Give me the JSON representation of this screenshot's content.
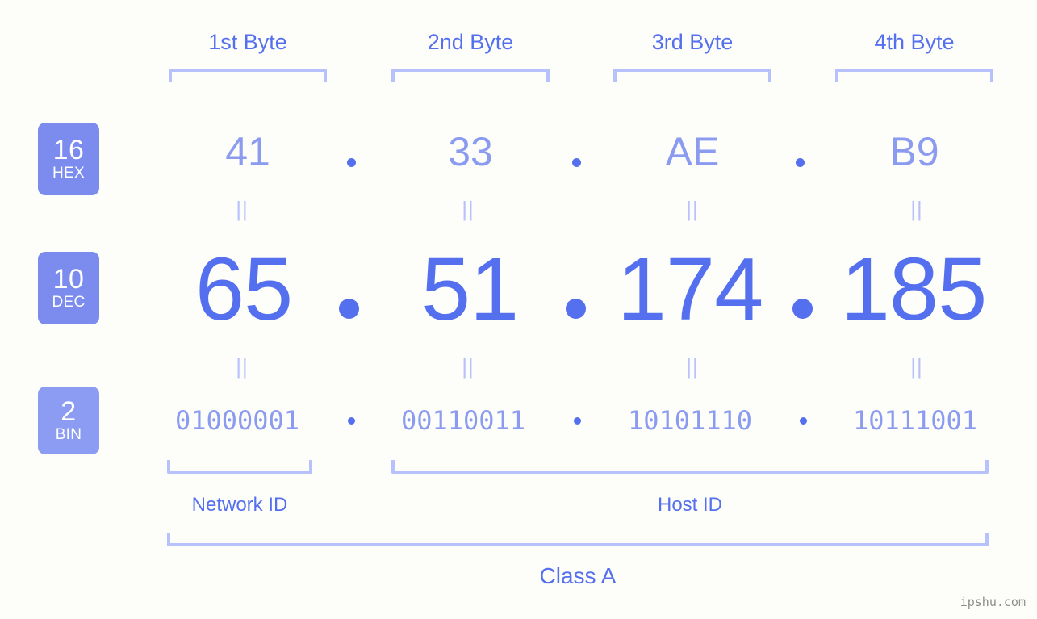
{
  "background_color": "#fdfdfa",
  "colors": {
    "accent_strong": "#5570ef",
    "accent_mid": "#8a9bf0",
    "accent_light": "#b7c1fb",
    "badge_fill": "#7b8cee",
    "badge_fill_light": "#8c9cf2",
    "watermark": "#8d8d8d"
  },
  "byte_headers": [
    {
      "label": "1st Byte"
    },
    {
      "label": "2nd Byte"
    },
    {
      "label": "3rd Byte"
    },
    {
      "label": "4th Byte"
    }
  ],
  "bases": [
    {
      "number": "16",
      "name": "HEX"
    },
    {
      "number": "10",
      "name": "DEC"
    },
    {
      "number": "2",
      "name": "BIN"
    }
  ],
  "equals_glyph": "||",
  "separator": ".",
  "rows": {
    "hex": {
      "base": "16",
      "name": "HEX",
      "values": [
        "41",
        "33",
        "AE",
        "B9"
      ]
    },
    "dec": {
      "base": "10",
      "name": "DEC",
      "values": [
        "65",
        "51",
        "174",
        "185"
      ]
    },
    "bin": {
      "base": "2",
      "name": "BIN",
      "values": [
        "01000001",
        "00110011",
        "10101110",
        "10111001"
      ]
    }
  },
  "segments": {
    "network_id": "Network ID",
    "host_id": "Host ID",
    "class": "Class A"
  },
  "watermark": "ipshu.com"
}
